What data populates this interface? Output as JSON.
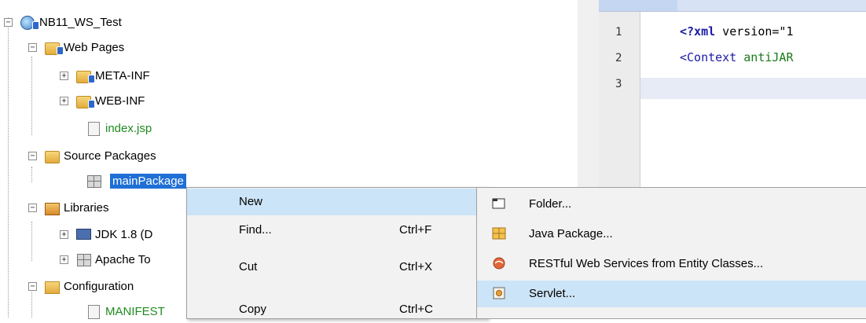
{
  "tree": {
    "items": [
      {
        "label": "NB11_WS_Test"
      },
      {
        "label": "Web Pages"
      },
      {
        "label": "META-INF"
      },
      {
        "label": "WEB-INF"
      },
      {
        "label": "index.jsp"
      },
      {
        "label": "Source Packages"
      },
      {
        "label": "mainPackage"
      },
      {
        "label": "Libraries"
      },
      {
        "label": "JDK 1.8 (D"
      },
      {
        "label": "Apache To"
      },
      {
        "label": "Configuration"
      },
      {
        "label": "MANIFEST"
      }
    ]
  },
  "editor": {
    "line_numbers": [
      "1",
      "2",
      "3"
    ],
    "line1_tag": "<?xml",
    "line1_rest": " version=\"1",
    "line2_tag": "<Context",
    "line2_attr": " antiJAR"
  },
  "context_menu": {
    "items": [
      {
        "label": "New",
        "shortcut": ""
      },
      {
        "label": "Find...",
        "shortcut": "Ctrl+F"
      },
      {
        "label": "Cut",
        "shortcut": "Ctrl+X"
      },
      {
        "label": "Copy",
        "shortcut": "Ctrl+C"
      }
    ],
    "submenu_arrow": "›"
  },
  "submenu": {
    "items": [
      {
        "label": "Folder...",
        "icon": "folder-icon"
      },
      {
        "label": "Java Package...",
        "icon": "package-icon"
      },
      {
        "label": "RESTful Web Services from Entity Classes...",
        "icon": "rest-service-icon"
      },
      {
        "label": "Servlet...",
        "icon": "servlet-icon"
      }
    ]
  },
  "colors": {
    "selection": "#1f6fd6",
    "menu_highlight": "#cce4f7",
    "green_text": "#1f8b1f"
  }
}
